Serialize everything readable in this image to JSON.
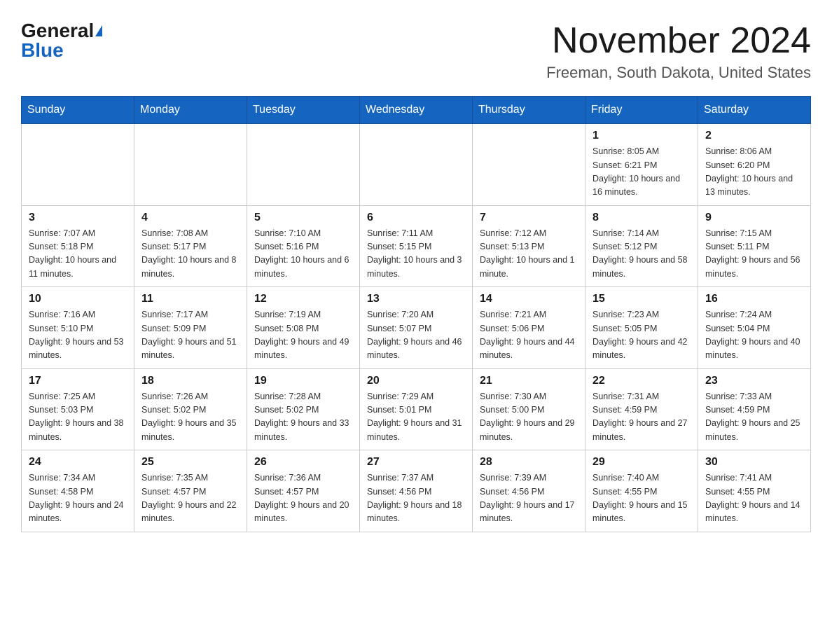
{
  "header": {
    "logo_general": "General",
    "logo_blue": "Blue",
    "month_title": "November 2024",
    "location": "Freeman, South Dakota, United States"
  },
  "weekdays": [
    "Sunday",
    "Monday",
    "Tuesday",
    "Wednesday",
    "Thursday",
    "Friday",
    "Saturday"
  ],
  "weeks": [
    [
      {
        "day": "",
        "info": ""
      },
      {
        "day": "",
        "info": ""
      },
      {
        "day": "",
        "info": ""
      },
      {
        "day": "",
        "info": ""
      },
      {
        "day": "",
        "info": ""
      },
      {
        "day": "1",
        "info": "Sunrise: 8:05 AM\nSunset: 6:21 PM\nDaylight: 10 hours and 16 minutes."
      },
      {
        "day": "2",
        "info": "Sunrise: 8:06 AM\nSunset: 6:20 PM\nDaylight: 10 hours and 13 minutes."
      }
    ],
    [
      {
        "day": "3",
        "info": "Sunrise: 7:07 AM\nSunset: 5:18 PM\nDaylight: 10 hours and 11 minutes."
      },
      {
        "day": "4",
        "info": "Sunrise: 7:08 AM\nSunset: 5:17 PM\nDaylight: 10 hours and 8 minutes."
      },
      {
        "day": "5",
        "info": "Sunrise: 7:10 AM\nSunset: 5:16 PM\nDaylight: 10 hours and 6 minutes."
      },
      {
        "day": "6",
        "info": "Sunrise: 7:11 AM\nSunset: 5:15 PM\nDaylight: 10 hours and 3 minutes."
      },
      {
        "day": "7",
        "info": "Sunrise: 7:12 AM\nSunset: 5:13 PM\nDaylight: 10 hours and 1 minute."
      },
      {
        "day": "8",
        "info": "Sunrise: 7:14 AM\nSunset: 5:12 PM\nDaylight: 9 hours and 58 minutes."
      },
      {
        "day": "9",
        "info": "Sunrise: 7:15 AM\nSunset: 5:11 PM\nDaylight: 9 hours and 56 minutes."
      }
    ],
    [
      {
        "day": "10",
        "info": "Sunrise: 7:16 AM\nSunset: 5:10 PM\nDaylight: 9 hours and 53 minutes."
      },
      {
        "day": "11",
        "info": "Sunrise: 7:17 AM\nSunset: 5:09 PM\nDaylight: 9 hours and 51 minutes."
      },
      {
        "day": "12",
        "info": "Sunrise: 7:19 AM\nSunset: 5:08 PM\nDaylight: 9 hours and 49 minutes."
      },
      {
        "day": "13",
        "info": "Sunrise: 7:20 AM\nSunset: 5:07 PM\nDaylight: 9 hours and 46 minutes."
      },
      {
        "day": "14",
        "info": "Sunrise: 7:21 AM\nSunset: 5:06 PM\nDaylight: 9 hours and 44 minutes."
      },
      {
        "day": "15",
        "info": "Sunrise: 7:23 AM\nSunset: 5:05 PM\nDaylight: 9 hours and 42 minutes."
      },
      {
        "day": "16",
        "info": "Sunrise: 7:24 AM\nSunset: 5:04 PM\nDaylight: 9 hours and 40 minutes."
      }
    ],
    [
      {
        "day": "17",
        "info": "Sunrise: 7:25 AM\nSunset: 5:03 PM\nDaylight: 9 hours and 38 minutes."
      },
      {
        "day": "18",
        "info": "Sunrise: 7:26 AM\nSunset: 5:02 PM\nDaylight: 9 hours and 35 minutes."
      },
      {
        "day": "19",
        "info": "Sunrise: 7:28 AM\nSunset: 5:02 PM\nDaylight: 9 hours and 33 minutes."
      },
      {
        "day": "20",
        "info": "Sunrise: 7:29 AM\nSunset: 5:01 PM\nDaylight: 9 hours and 31 minutes."
      },
      {
        "day": "21",
        "info": "Sunrise: 7:30 AM\nSunset: 5:00 PM\nDaylight: 9 hours and 29 minutes."
      },
      {
        "day": "22",
        "info": "Sunrise: 7:31 AM\nSunset: 4:59 PM\nDaylight: 9 hours and 27 minutes."
      },
      {
        "day": "23",
        "info": "Sunrise: 7:33 AM\nSunset: 4:59 PM\nDaylight: 9 hours and 25 minutes."
      }
    ],
    [
      {
        "day": "24",
        "info": "Sunrise: 7:34 AM\nSunset: 4:58 PM\nDaylight: 9 hours and 24 minutes."
      },
      {
        "day": "25",
        "info": "Sunrise: 7:35 AM\nSunset: 4:57 PM\nDaylight: 9 hours and 22 minutes."
      },
      {
        "day": "26",
        "info": "Sunrise: 7:36 AM\nSunset: 4:57 PM\nDaylight: 9 hours and 20 minutes."
      },
      {
        "day": "27",
        "info": "Sunrise: 7:37 AM\nSunset: 4:56 PM\nDaylight: 9 hours and 18 minutes."
      },
      {
        "day": "28",
        "info": "Sunrise: 7:39 AM\nSunset: 4:56 PM\nDaylight: 9 hours and 17 minutes."
      },
      {
        "day": "29",
        "info": "Sunrise: 7:40 AM\nSunset: 4:55 PM\nDaylight: 9 hours and 15 minutes."
      },
      {
        "day": "30",
        "info": "Sunrise: 7:41 AM\nSunset: 4:55 PM\nDaylight: 9 hours and 14 minutes."
      }
    ]
  ]
}
